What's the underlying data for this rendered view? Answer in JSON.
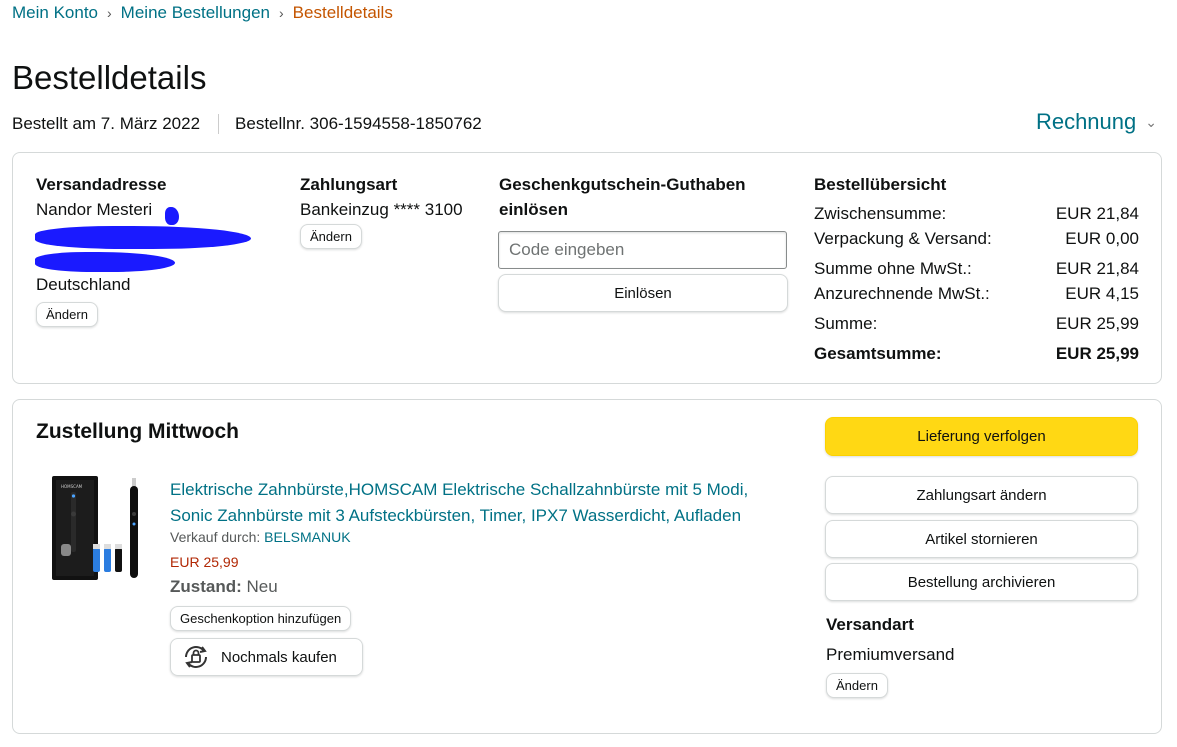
{
  "breadcrumb": {
    "items": [
      "Mein Konto",
      "Meine Bestellungen"
    ],
    "current": "Bestelldetails",
    "separator": "›"
  },
  "page_title": "Bestelldetails",
  "order": {
    "date_text": "Bestellt am 7. März 2022",
    "number_text": "Bestellnr. 306-1594558-1850762"
  },
  "invoice": {
    "label": "Rechnung",
    "chevron_icon": "chevron-down-icon"
  },
  "shipping_address": {
    "heading": "Versandadresse",
    "name": "Nandor Mesteri",
    "country": "Deutschland",
    "change_label": "Ändern"
  },
  "payment": {
    "heading": "Zahlungsart",
    "method": "Bankeinzug **** 3100",
    "change_label": "Ändern"
  },
  "gift_card": {
    "heading": "Geschenkgutschein-Guthaben einlösen",
    "placeholder": "Code eingeben",
    "redeem_label": "Einlösen"
  },
  "summary": {
    "heading": "Bestellübersicht",
    "rows": [
      {
        "label": "Zwischensumme:",
        "value": "EUR 21,84"
      },
      {
        "label": "Verpackung & Versand:",
        "value": "EUR 0,00"
      },
      {
        "label": "Summe ohne MwSt.:",
        "value": "EUR 21,84"
      },
      {
        "label": "Anzurechnende MwSt.:",
        "value": "EUR 4,15"
      },
      {
        "label": "Summe:",
        "value": "EUR 25,99"
      },
      {
        "label": "Gesamtsumme:",
        "value": "EUR 25,99"
      }
    ]
  },
  "delivery": {
    "heading": "Zustellung Mittwoch",
    "product": {
      "title": "Elektrische Zahnbürste,HOMSCAM Elektrische Schallzahnbürste mit 5 Modi, Sonic Zahnbürste mit 3 Aufsteckbürsten, Timer, IPX7 Wasserdicht, Aufladen",
      "sold_by_label": "Verkauf durch:",
      "seller": "BELSMANUK",
      "price": "EUR 25,99",
      "condition_label": "Zustand:",
      "condition_value": "Neu",
      "gift_option_label": "Geschenkoption hinzufügen",
      "buy_again_label": "Nochmals kaufen"
    },
    "actions": {
      "track": "Lieferung verfolgen",
      "change_payment": "Zahlungsart ändern",
      "cancel": "Artikel stornieren",
      "archive": "Bestellung archivieren"
    },
    "shipping_method": {
      "heading": "Versandart",
      "value": "Premiumversand",
      "change_label": "Ändern"
    }
  },
  "colors": {
    "link": "#007185",
    "breadcrumb_current": "#c45500",
    "price": "#b12704",
    "primary_button": "#ffd814",
    "redaction": "#1a1aff"
  }
}
